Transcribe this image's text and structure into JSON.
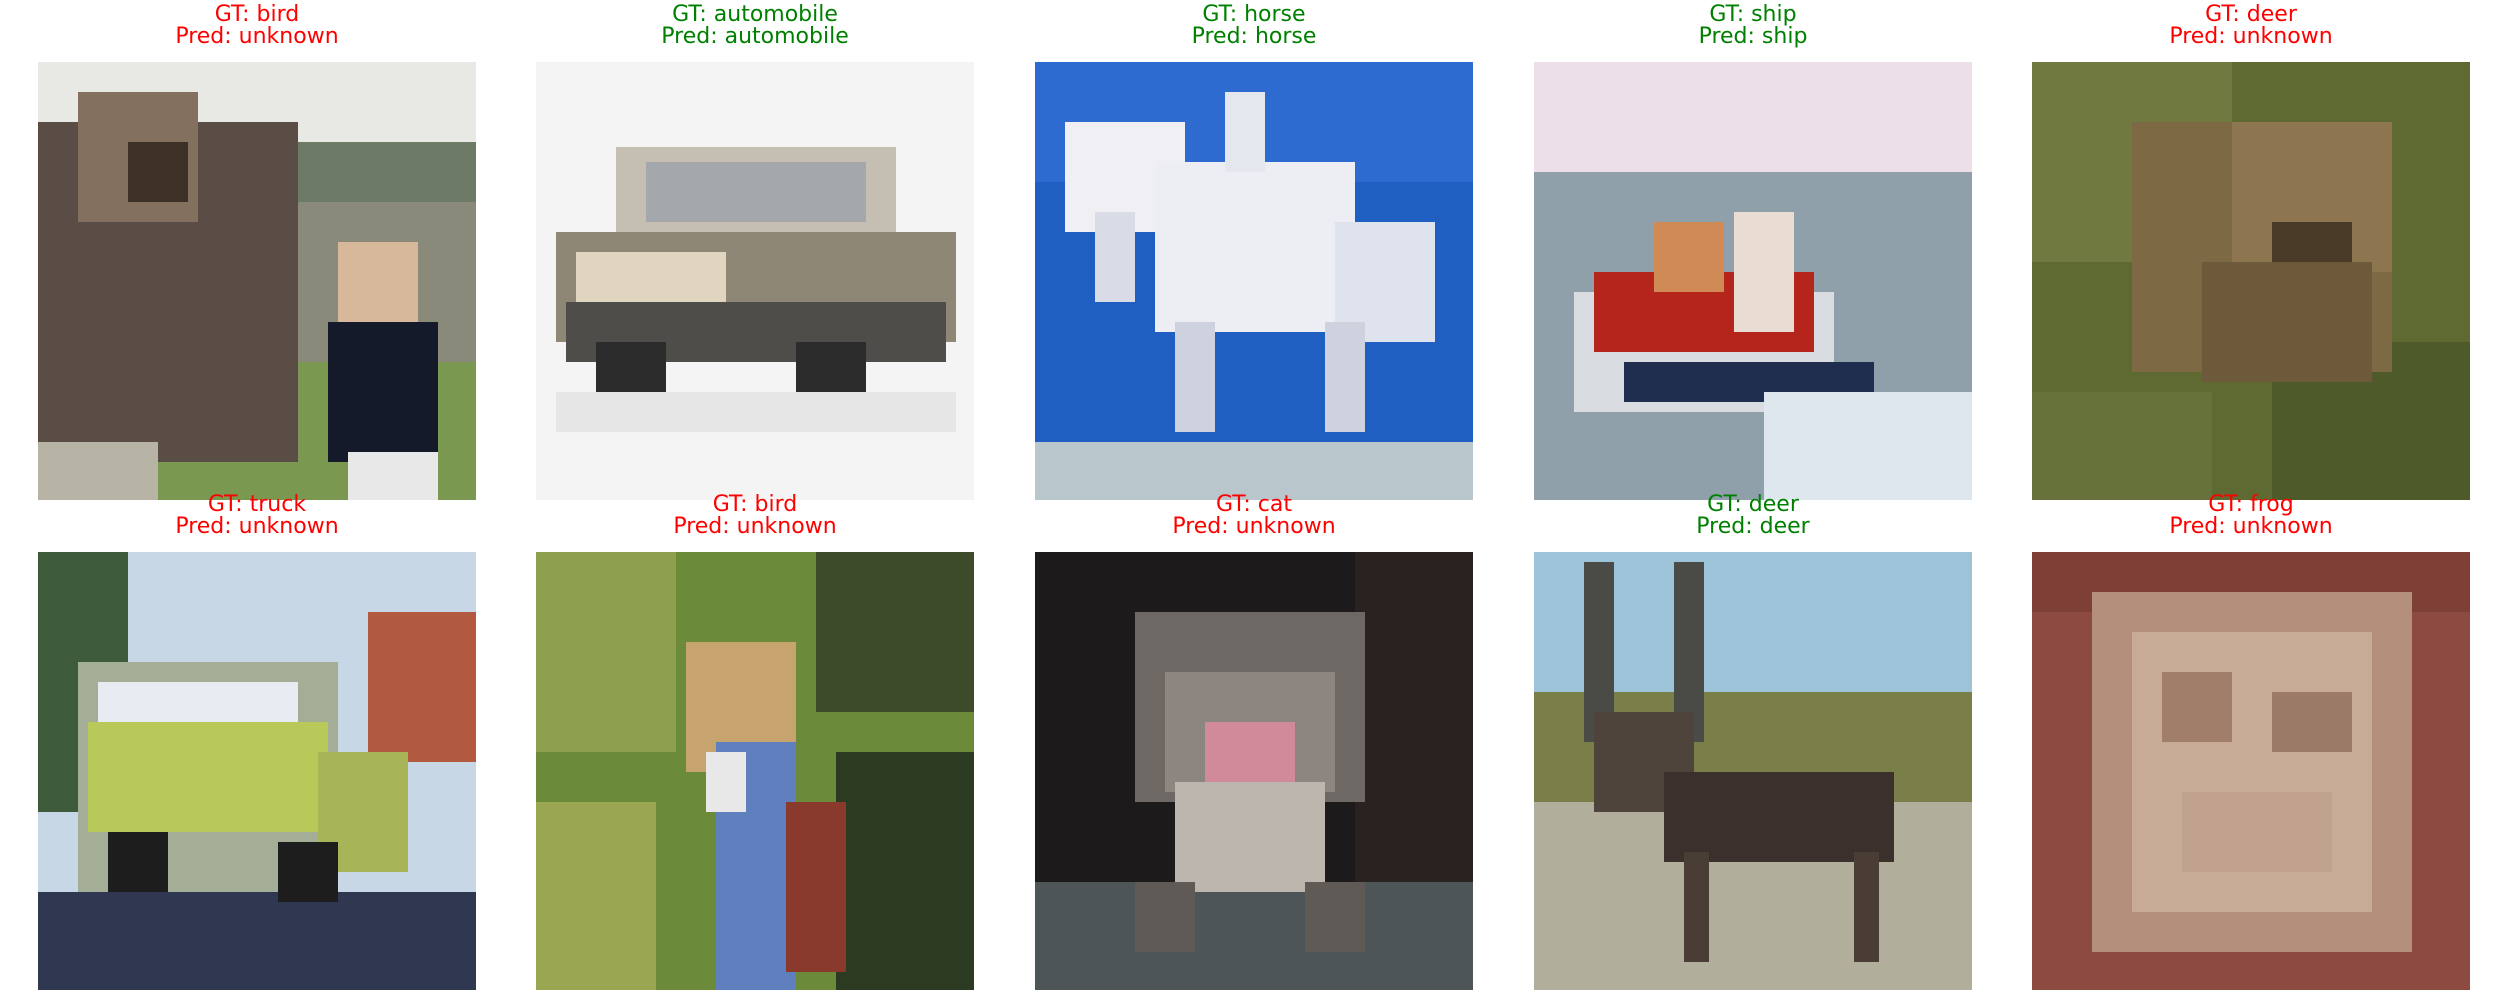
{
  "colors": {
    "correct": "#008000",
    "incorrect": "#ff0000"
  },
  "samples": [
    {
      "gt": "GT: bird",
      "pred": "Pred: unknown",
      "correct": false,
      "image": "bird-and-person-thumbnail"
    },
    {
      "gt": "GT: automobile",
      "pred": "Pred: automobile",
      "correct": true,
      "image": "car-thumbnail"
    },
    {
      "gt": "GT: horse",
      "pred": "Pred: horse",
      "correct": true,
      "image": "white-horse-thumbnail"
    },
    {
      "gt": "GT: ship",
      "pred": "Pred: ship",
      "correct": true,
      "image": "ship-thumbnail"
    },
    {
      "gt": "GT: deer",
      "pred": "Pred: unknown",
      "correct": false,
      "image": "deer-in-grass-thumbnail"
    },
    {
      "gt": "GT: truck",
      "pred": "Pred: unknown",
      "correct": false,
      "image": "fire-truck-thumbnail"
    },
    {
      "gt": "GT: bird",
      "pred": "Pred: unknown",
      "correct": false,
      "image": "child-with-leaves-thumbnail"
    },
    {
      "gt": "GT: cat",
      "pred": "Pred: unknown",
      "correct": false,
      "image": "cat-thumbnail"
    },
    {
      "gt": "GT: deer",
      "pred": "Pred: deer",
      "correct": true,
      "image": "reindeer-thumbnail"
    },
    {
      "gt": "GT: frog",
      "pred": "Pred: unknown",
      "correct": false,
      "image": "frog-thumbnail"
    }
  ]
}
